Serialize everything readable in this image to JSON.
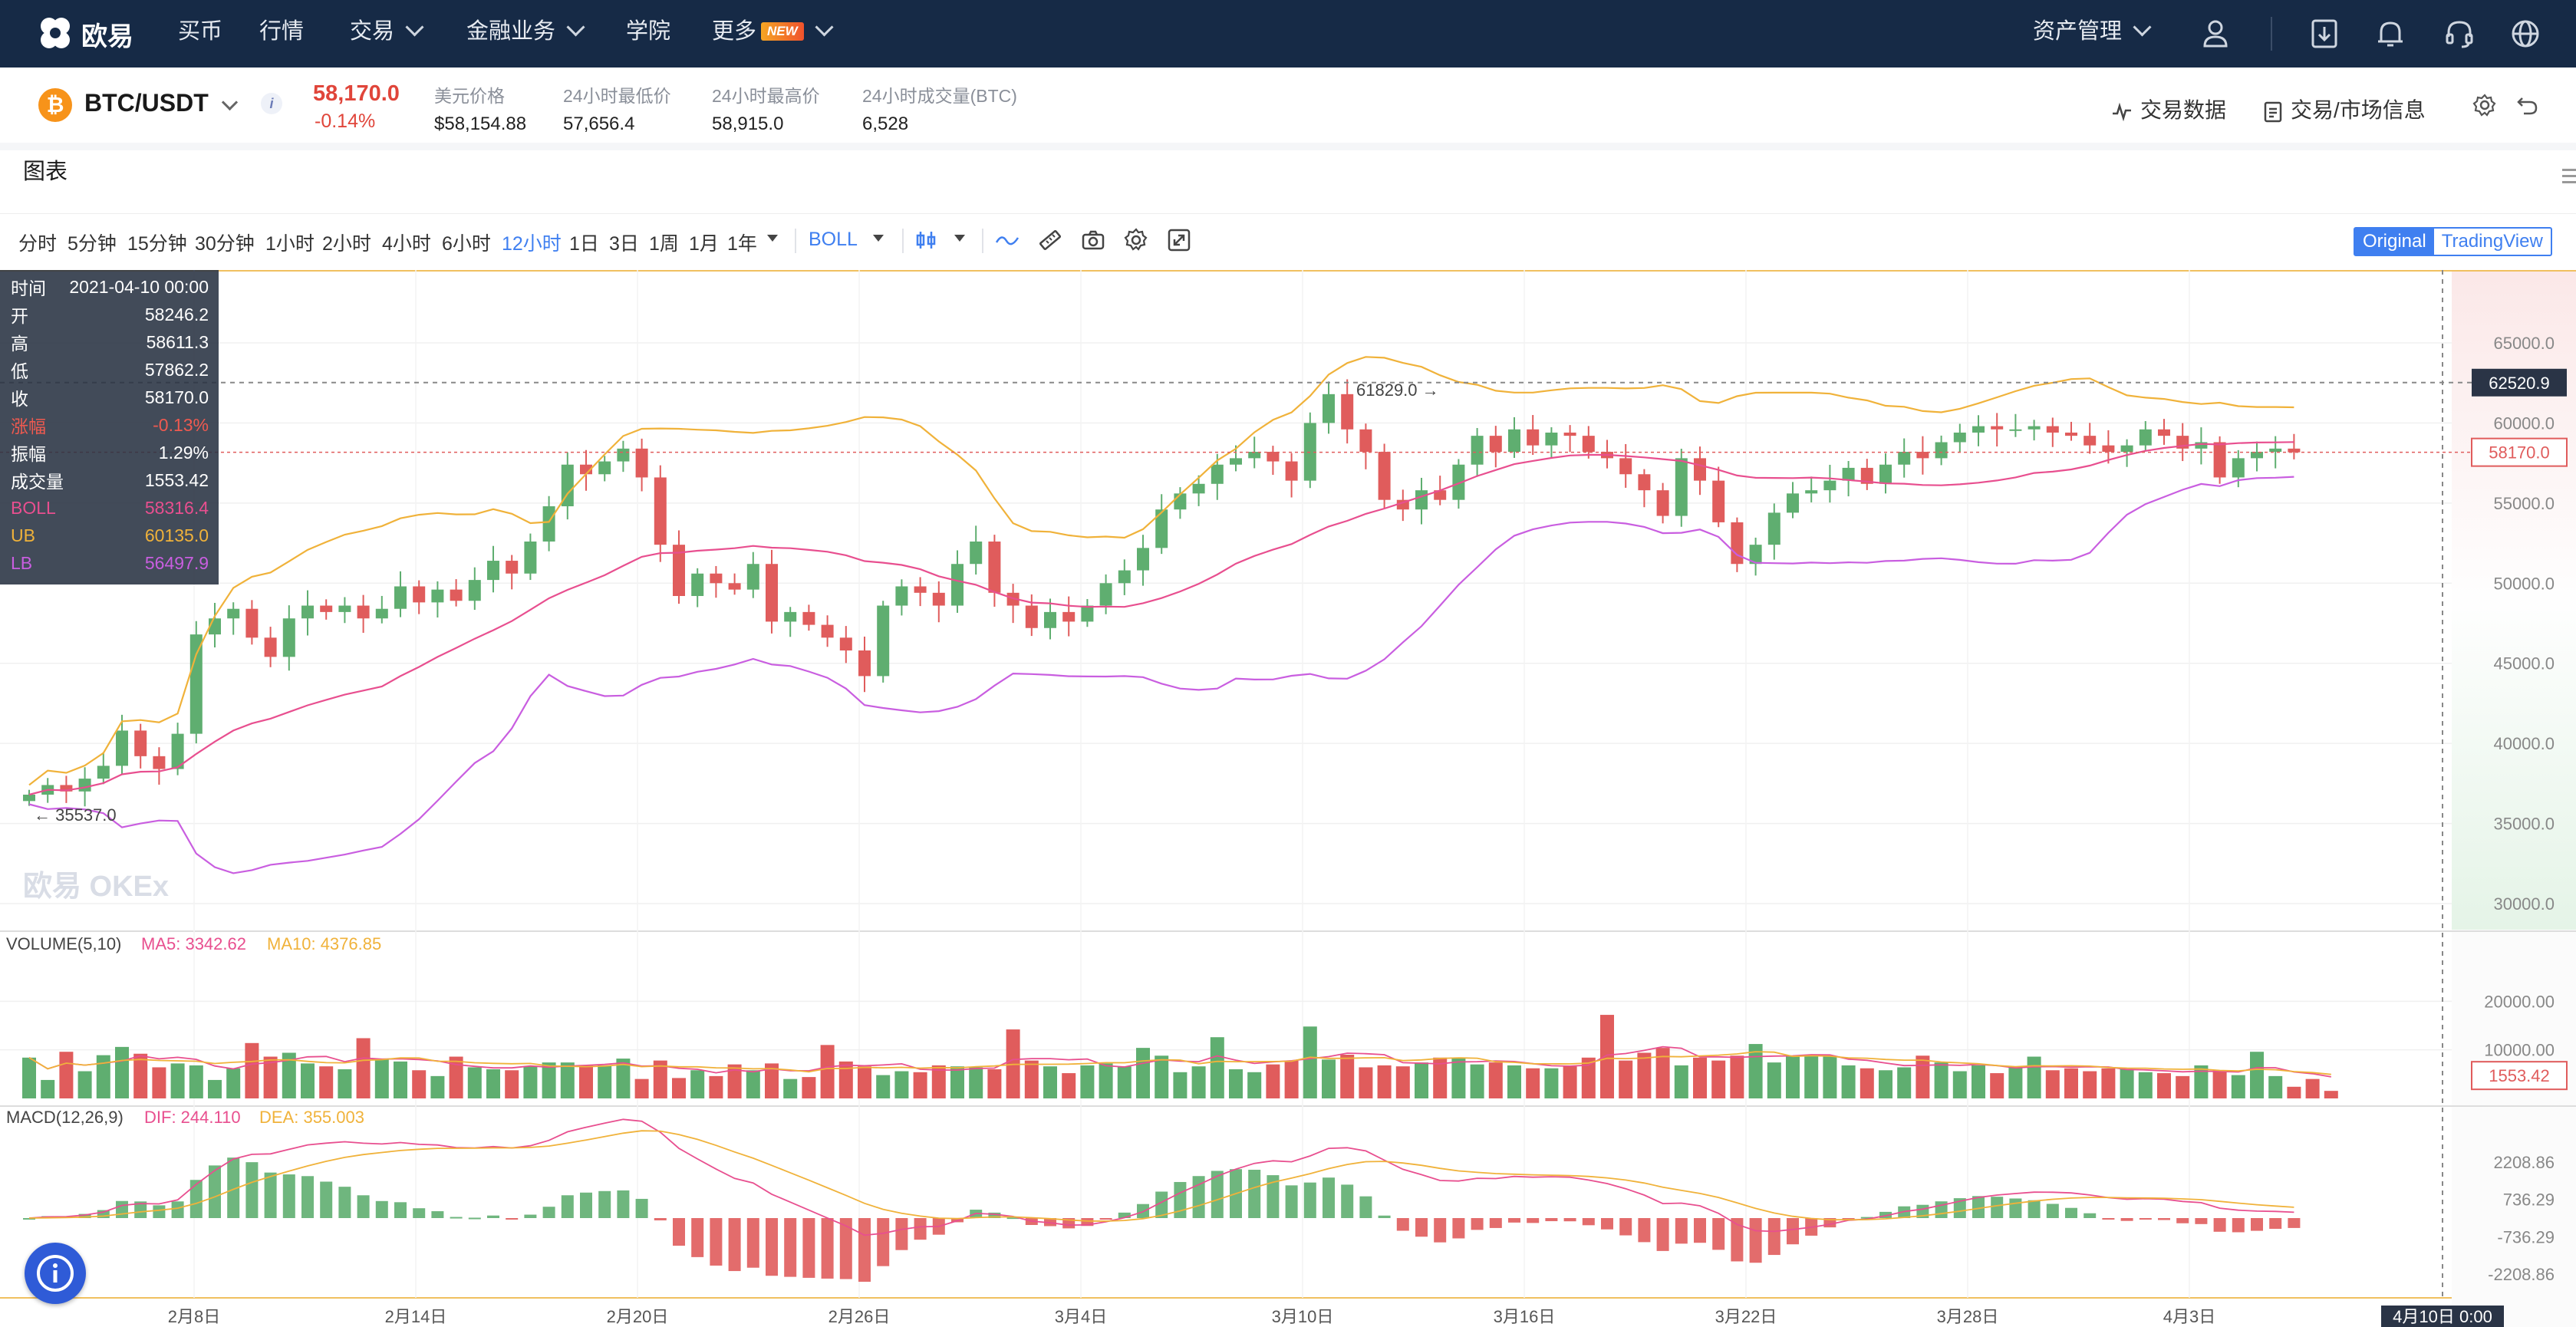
{
  "nav": {
    "logo_text": "欧易",
    "items": [
      {
        "label": "买币",
        "has_menu": false
      },
      {
        "label": "行情",
        "has_menu": false
      },
      {
        "label": "交易",
        "has_menu": true
      },
      {
        "label": "金融业务",
        "has_menu": true
      },
      {
        "label": "学院",
        "has_menu": false
      },
      {
        "label": "更多",
        "has_menu": true,
        "badge": "NEW"
      }
    ],
    "assets_label": "资产管理",
    "icons": [
      "user-icon",
      "download-icon",
      "bell-icon",
      "headset-icon",
      "globe-icon"
    ]
  },
  "ticker": {
    "coin_symbol": "₿",
    "pair": "BTC/USDT",
    "last_price": "58,170.0",
    "change_pct": "-0.14%",
    "stats": [
      {
        "label": "美元价格",
        "value": "$58,154.88"
      },
      {
        "label": "24小时最低价",
        "value": "57,656.4"
      },
      {
        "label": "24小时最高价",
        "value": "58,915.0"
      },
      {
        "label": "24小时成交量(BTC)",
        "value": "6,528"
      }
    ],
    "trade_data_label": "交易数据",
    "market_info_label": "交易/市场信息"
  },
  "panel": {
    "title": "图表",
    "timeframes": [
      "分时",
      "5分钟",
      "15分钟",
      "30分钟",
      "1小时",
      "2小时",
      "4小时",
      "6小时",
      "12小时",
      "1日",
      "3日",
      "1周",
      "1月",
      "1年"
    ],
    "active_timeframe": "12小时",
    "indicator": "BOLL",
    "mode_original": "Original",
    "mode_tradingview": "TradingView"
  },
  "ohlc": {
    "rows": [
      {
        "k": "时间",
        "v": "2021-04-10 00:00",
        "color": "#ffffff"
      },
      {
        "k": "开",
        "v": "58246.2",
        "color": "#ffffff"
      },
      {
        "k": "高",
        "v": "58611.3",
        "color": "#ffffff"
      },
      {
        "k": "低",
        "v": "57862.2",
        "color": "#ffffff"
      },
      {
        "k": "收",
        "v": "58170.0",
        "color": "#ffffff"
      },
      {
        "k": "涨幅",
        "v": "-0.13%",
        "color": "#ef5a50"
      },
      {
        "k": "振幅",
        "v": "1.29%",
        "color": "#ffffff"
      },
      {
        "k": "成交量",
        "v": "1553.42",
        "color": "#ffffff"
      },
      {
        "k": "BOLL",
        "v": "58316.4",
        "color": "#e84f8f"
      },
      {
        "k": "UB",
        "v": "60135.0",
        "color": "#f0b23a"
      },
      {
        "k": "LB",
        "v": "56497.9",
        "color": "#c95ee0"
      }
    ]
  },
  "chart_data": {
    "type": "candlestick",
    "price_axis": {
      "min": 30000,
      "max": 65000,
      "ticks": [
        "65000.0",
        "60000.0",
        "55000.0",
        "50000.0",
        "45000.0",
        "40000.0",
        "35000.0",
        "30000.0"
      ]
    },
    "x_ticks": [
      "2月8日",
      "2月14日",
      "2月20日",
      "2月26日",
      "3月4日",
      "3月10日",
      "3月16日",
      "3月22日",
      "3月28日",
      "4月3日"
    ],
    "crosshair": {
      "price_label": "62520.9",
      "time_label": "4月10日 0:00"
    },
    "last_price_label": "58170.0",
    "max_annotation": "61829.0 →",
    "min_annotation": "← 35537.0",
    "watermark": "欧易 OKEx",
    "closes": [
      36800,
      37400,
      37000,
      37800,
      38600,
      40800,
      39200,
      38400,
      40600,
      46800,
      47800,
      48400,
      46600,
      45400,
      47800,
      48600,
      48200,
      48600,
      47800,
      48400,
      49800,
      48800,
      49600,
      48900,
      50200,
      51400,
      50600,
      52600,
      54800,
      57400,
      56800,
      57600,
      58400,
      56600,
      52400,
      49200,
      50600,
      50000,
      49600,
      51200,
      47600,
      48200,
      47400,
      46600,
      45800,
      44200,
      48600,
      49800,
      49400,
      48600,
      51200,
      52600,
      49400,
      48600,
      47200,
      48200,
      47600,
      48600,
      50000,
      50800,
      52200,
      54600,
      55600,
      56200,
      57400,
      57800,
      58200,
      57600,
      56400,
      60000,
      61800,
      59600,
      58200,
      55200,
      54600,
      55800,
      55200,
      57400,
      59200,
      58200,
      59600,
      58600,
      59400,
      59200,
      58200,
      57800,
      56800,
      55800,
      54200,
      57800,
      56400,
      53800,
      51200,
      52400,
      54400,
      55600,
      55800,
      56400,
      57200,
      56200,
      57400,
      58200,
      57800,
      58800,
      59400,
      59800,
      59600,
      59600,
      59800,
      59400,
      59200,
      58600,
      58200,
      58600,
      59600,
      59200,
      58400,
      58800,
      56600,
      57800,
      58200,
      58400,
      58170
    ],
    "volume": {
      "label": "VOLUME(5,10)",
      "ma5": "MA5: 3342.62",
      "ma10": "MA10: 4376.85",
      "ticks": [
        "20000.00",
        "10000.00"
      ],
      "last_label": "1553.42",
      "max": 30000,
      "values": [
        8400,
        3800,
        9600,
        5600,
        8900,
        10600,
        9200,
        6400,
        7200,
        6800,
        3800,
        6200,
        11400,
        8600,
        9400,
        7200,
        6600,
        6000,
        12400,
        8200,
        7600,
        5800,
        4600,
        8600,
        6400,
        6000,
        5800,
        6600,
        7400,
        7400,
        6800,
        6800,
        8200,
        4000,
        7800,
        4200,
        5800,
        4600,
        7000,
        5800,
        7200,
        4000,
        4400,
        11000,
        7600,
        6600,
        4800,
        5600,
        5400,
        6800,
        6600,
        6400,
        6000,
        14200,
        7800,
        6600,
        5200,
        6800,
        7200,
        6600,
        10400,
        8800,
        5400,
        6600,
        12600,
        6000,
        5400,
        7000,
        7800,
        14800,
        8000,
        9000,
        6400,
        6800,
        6600,
        7400,
        8400,
        8400,
        7000,
        7400,
        6800,
        6200,
        6200,
        6600,
        8400,
        17200,
        7800,
        9400,
        10400,
        6800,
        8400,
        7800,
        8800,
        11200,
        7400,
        8600,
        9000,
        8600,
        6800,
        6200,
        5800,
        6400,
        8800,
        7400,
        5600,
        6800,
        5200,
        6400,
        8600,
        5800,
        6200,
        5600,
        6200,
        6000,
        5400,
        5200,
        4600,
        6800,
        5800,
        4800,
        9600,
        4600,
        2400,
        4000,
        1553
      ]
    },
    "macd": {
      "label": "MACD(12,26,9)",
      "dif": "DIF: 244.110",
      "dea": "DEA: 355.003",
      "ticks": [
        "2208.86",
        "736.29",
        "-736.29",
        "-2208.86"
      ],
      "max": 3500
    }
  }
}
